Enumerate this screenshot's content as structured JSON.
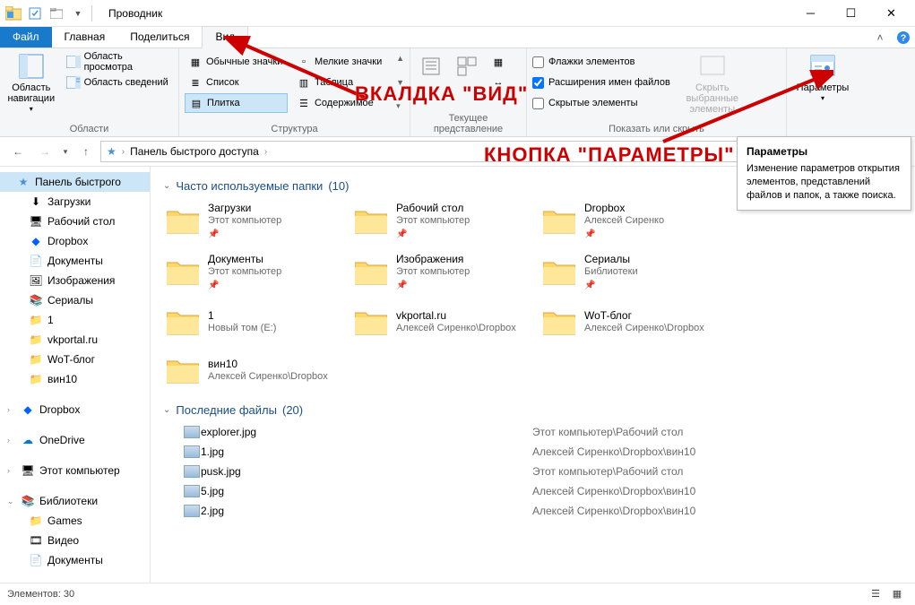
{
  "title": "Проводник",
  "tabs": {
    "file": "Файл",
    "home": "Главная",
    "share": "Поделиться",
    "view": "Вид"
  },
  "ribbon": {
    "panes": {
      "nav_pane": "Область навигации",
      "preview": "Область просмотра",
      "details": "Область сведений",
      "group_label": "Области"
    },
    "layout": {
      "regular": "Обычные значки",
      "small": "Мелкие значки",
      "list": "Список",
      "table": "Таблица",
      "tiles": "Плитка",
      "content": "Содержимое",
      "group_label": "Структура"
    },
    "current_view": {
      "group_label": "Текущее представление"
    },
    "show": {
      "checkboxes": "Флажки элементов",
      "extensions": "Расширения имен файлов",
      "hidden": "Скрытые элементы",
      "hide_selected": "Скрыть выбранные элементы",
      "group_label": "Показать или скрыть"
    },
    "options": "Параметры"
  },
  "breadcrumb": {
    "location": "Панель быстрого доступа"
  },
  "tree": {
    "quick_access": "Панель быстрого",
    "downloads": "Загрузки",
    "desktop": "Рабочий стол",
    "dropbox": "Dropbox",
    "documents": "Документы",
    "pictures": "Изображения",
    "serials": "Сериалы",
    "one": "1",
    "vkportal": "vkportal.ru",
    "wot": "WoT-блог",
    "win10": "вин10",
    "dropbox_root": "Dropbox",
    "onedrive": "OneDrive",
    "this_pc": "Этот компьютер",
    "libraries": "Библиотеки",
    "games": "Games",
    "video": "Видео",
    "docs": "Документы"
  },
  "section_freq": {
    "title": "Часто используемые папки",
    "count": "(10)"
  },
  "folders": [
    {
      "name": "Загрузки",
      "sub": "Этот компьютер",
      "pinned": true
    },
    {
      "name": "Рабочий стол",
      "sub": "Этот компьютер",
      "pinned": true
    },
    {
      "name": "Dropbox",
      "sub": "Алексей Сиренко",
      "pinned": true
    },
    {
      "name": "Документы",
      "sub": "Этот компьютер",
      "pinned": true
    },
    {
      "name": "Изображения",
      "sub": "Этот компьютер",
      "pinned": true
    },
    {
      "name": "Сериалы",
      "sub": "Библиотеки",
      "pinned": true
    },
    {
      "name": "1",
      "sub": "Новый том (E:)",
      "pinned": false
    },
    {
      "name": "vkportal.ru",
      "sub": "Алексей Сиренко\\Dropbox",
      "pinned": false
    },
    {
      "name": "WoT-блог",
      "sub": "Алексей Сиренко\\Dropbox",
      "pinned": false
    },
    {
      "name": "вин10",
      "sub": "Алексей Сиренко\\Dropbox",
      "pinned": false
    }
  ],
  "section_recent": {
    "title": "Последние файлы",
    "count": "(20)"
  },
  "files": [
    {
      "name": "explorer.jpg",
      "path": "Этот компьютер\\Рабочий стол"
    },
    {
      "name": "1.jpg",
      "path": "Алексей Сиренко\\Dropbox\\вин10"
    },
    {
      "name": "pusk.jpg",
      "path": "Этот компьютер\\Рабочий стол"
    },
    {
      "name": "5.jpg",
      "path": "Алексей Сиренко\\Dropbox\\вин10"
    },
    {
      "name": "2.jpg",
      "path": "Алексей Сиренко\\Dropbox\\вин10"
    }
  ],
  "status": {
    "items": "Элементов: 30"
  },
  "tooltip": {
    "title": "Параметры",
    "body": "Изменение параметров открытия элементов, представлений файлов и папок, а также поиска."
  },
  "annotations": {
    "tab": "ВКАЛДКА \"ВИД\"",
    "button": "КНОПКА \"ПАРАМЕТРЫ\""
  }
}
